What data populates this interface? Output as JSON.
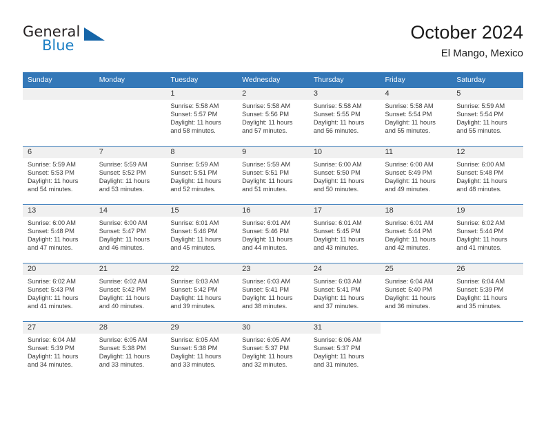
{
  "brand": {
    "name_top": "General",
    "name_bottom": "Blue",
    "triangle_icon": "triangle-logo-icon",
    "color_blue": "#1c7fc4",
    "color_triangle": "#1565a8"
  },
  "header": {
    "title": "October 2024",
    "subtitle": "El Mango, Mexico"
  },
  "colors": {
    "header_row_bg": "#3478b8",
    "header_row_text": "#ffffff",
    "daynum_bar_bg": "#f0f0f0",
    "grid_line": "#3478b8",
    "body_text": "#3a3a3a"
  },
  "weekday_headers": [
    "Sunday",
    "Monday",
    "Tuesday",
    "Wednesday",
    "Thursday",
    "Friday",
    "Saturday"
  ],
  "weeks": [
    [
      {
        "day": "",
        "sunrise": "",
        "sunset": "",
        "daylight_line1": "",
        "daylight_line2": ""
      },
      {
        "day": "",
        "sunrise": "",
        "sunset": "",
        "daylight_line1": "",
        "daylight_line2": ""
      },
      {
        "day": "1",
        "sunrise": "Sunrise: 5:58 AM",
        "sunset": "Sunset: 5:57 PM",
        "daylight_line1": "Daylight: 11 hours",
        "daylight_line2": "and 58 minutes."
      },
      {
        "day": "2",
        "sunrise": "Sunrise: 5:58 AM",
        "sunset": "Sunset: 5:56 PM",
        "daylight_line1": "Daylight: 11 hours",
        "daylight_line2": "and 57 minutes."
      },
      {
        "day": "3",
        "sunrise": "Sunrise: 5:58 AM",
        "sunset": "Sunset: 5:55 PM",
        "daylight_line1": "Daylight: 11 hours",
        "daylight_line2": "and 56 minutes."
      },
      {
        "day": "4",
        "sunrise": "Sunrise: 5:58 AM",
        "sunset": "Sunset: 5:54 PM",
        "daylight_line1": "Daylight: 11 hours",
        "daylight_line2": "and 55 minutes."
      },
      {
        "day": "5",
        "sunrise": "Sunrise: 5:59 AM",
        "sunset": "Sunset: 5:54 PM",
        "daylight_line1": "Daylight: 11 hours",
        "daylight_line2": "and 55 minutes."
      }
    ],
    [
      {
        "day": "6",
        "sunrise": "Sunrise: 5:59 AM",
        "sunset": "Sunset: 5:53 PM",
        "daylight_line1": "Daylight: 11 hours",
        "daylight_line2": "and 54 minutes."
      },
      {
        "day": "7",
        "sunrise": "Sunrise: 5:59 AM",
        "sunset": "Sunset: 5:52 PM",
        "daylight_line1": "Daylight: 11 hours",
        "daylight_line2": "and 53 minutes."
      },
      {
        "day": "8",
        "sunrise": "Sunrise: 5:59 AM",
        "sunset": "Sunset: 5:51 PM",
        "daylight_line1": "Daylight: 11 hours",
        "daylight_line2": "and 52 minutes."
      },
      {
        "day": "9",
        "sunrise": "Sunrise: 5:59 AM",
        "sunset": "Sunset: 5:51 PM",
        "daylight_line1": "Daylight: 11 hours",
        "daylight_line2": "and 51 minutes."
      },
      {
        "day": "10",
        "sunrise": "Sunrise: 6:00 AM",
        "sunset": "Sunset: 5:50 PM",
        "daylight_line1": "Daylight: 11 hours",
        "daylight_line2": "and 50 minutes."
      },
      {
        "day": "11",
        "sunrise": "Sunrise: 6:00 AM",
        "sunset": "Sunset: 5:49 PM",
        "daylight_line1": "Daylight: 11 hours",
        "daylight_line2": "and 49 minutes."
      },
      {
        "day": "12",
        "sunrise": "Sunrise: 6:00 AM",
        "sunset": "Sunset: 5:48 PM",
        "daylight_line1": "Daylight: 11 hours",
        "daylight_line2": "and 48 minutes."
      }
    ],
    [
      {
        "day": "13",
        "sunrise": "Sunrise: 6:00 AM",
        "sunset": "Sunset: 5:48 PM",
        "daylight_line1": "Daylight: 11 hours",
        "daylight_line2": "and 47 minutes."
      },
      {
        "day": "14",
        "sunrise": "Sunrise: 6:00 AM",
        "sunset": "Sunset: 5:47 PM",
        "daylight_line1": "Daylight: 11 hours",
        "daylight_line2": "and 46 minutes."
      },
      {
        "day": "15",
        "sunrise": "Sunrise: 6:01 AM",
        "sunset": "Sunset: 5:46 PM",
        "daylight_line1": "Daylight: 11 hours",
        "daylight_line2": "and 45 minutes."
      },
      {
        "day": "16",
        "sunrise": "Sunrise: 6:01 AM",
        "sunset": "Sunset: 5:46 PM",
        "daylight_line1": "Daylight: 11 hours",
        "daylight_line2": "and 44 minutes."
      },
      {
        "day": "17",
        "sunrise": "Sunrise: 6:01 AM",
        "sunset": "Sunset: 5:45 PM",
        "daylight_line1": "Daylight: 11 hours",
        "daylight_line2": "and 43 minutes."
      },
      {
        "day": "18",
        "sunrise": "Sunrise: 6:01 AM",
        "sunset": "Sunset: 5:44 PM",
        "daylight_line1": "Daylight: 11 hours",
        "daylight_line2": "and 42 minutes."
      },
      {
        "day": "19",
        "sunrise": "Sunrise: 6:02 AM",
        "sunset": "Sunset: 5:44 PM",
        "daylight_line1": "Daylight: 11 hours",
        "daylight_line2": "and 41 minutes."
      }
    ],
    [
      {
        "day": "20",
        "sunrise": "Sunrise: 6:02 AM",
        "sunset": "Sunset: 5:43 PM",
        "daylight_line1": "Daylight: 11 hours",
        "daylight_line2": "and 41 minutes."
      },
      {
        "day": "21",
        "sunrise": "Sunrise: 6:02 AM",
        "sunset": "Sunset: 5:42 PM",
        "daylight_line1": "Daylight: 11 hours",
        "daylight_line2": "and 40 minutes."
      },
      {
        "day": "22",
        "sunrise": "Sunrise: 6:03 AM",
        "sunset": "Sunset: 5:42 PM",
        "daylight_line1": "Daylight: 11 hours",
        "daylight_line2": "and 39 minutes."
      },
      {
        "day": "23",
        "sunrise": "Sunrise: 6:03 AM",
        "sunset": "Sunset: 5:41 PM",
        "daylight_line1": "Daylight: 11 hours",
        "daylight_line2": "and 38 minutes."
      },
      {
        "day": "24",
        "sunrise": "Sunrise: 6:03 AM",
        "sunset": "Sunset: 5:41 PM",
        "daylight_line1": "Daylight: 11 hours",
        "daylight_line2": "and 37 minutes."
      },
      {
        "day": "25",
        "sunrise": "Sunrise: 6:04 AM",
        "sunset": "Sunset: 5:40 PM",
        "daylight_line1": "Daylight: 11 hours",
        "daylight_line2": "and 36 minutes."
      },
      {
        "day": "26",
        "sunrise": "Sunrise: 6:04 AM",
        "sunset": "Sunset: 5:39 PM",
        "daylight_line1": "Daylight: 11 hours",
        "daylight_line2": "and 35 minutes."
      }
    ],
    [
      {
        "day": "27",
        "sunrise": "Sunrise: 6:04 AM",
        "sunset": "Sunset: 5:39 PM",
        "daylight_line1": "Daylight: 11 hours",
        "daylight_line2": "and 34 minutes."
      },
      {
        "day": "28",
        "sunrise": "Sunrise: 6:05 AM",
        "sunset": "Sunset: 5:38 PM",
        "daylight_line1": "Daylight: 11 hours",
        "daylight_line2": "and 33 minutes."
      },
      {
        "day": "29",
        "sunrise": "Sunrise: 6:05 AM",
        "sunset": "Sunset: 5:38 PM",
        "daylight_line1": "Daylight: 11 hours",
        "daylight_line2": "and 33 minutes."
      },
      {
        "day": "30",
        "sunrise": "Sunrise: 6:05 AM",
        "sunset": "Sunset: 5:37 PM",
        "daylight_line1": "Daylight: 11 hours",
        "daylight_line2": "and 32 minutes."
      },
      {
        "day": "31",
        "sunrise": "Sunrise: 6:06 AM",
        "sunset": "Sunset: 5:37 PM",
        "daylight_line1": "Daylight: 11 hours",
        "daylight_line2": "and 31 minutes."
      },
      {
        "day": "",
        "sunrise": "",
        "sunset": "",
        "daylight_line1": "",
        "daylight_line2": ""
      },
      {
        "day": "",
        "sunrise": "",
        "sunset": "",
        "daylight_line1": "",
        "daylight_line2": ""
      }
    ]
  ]
}
